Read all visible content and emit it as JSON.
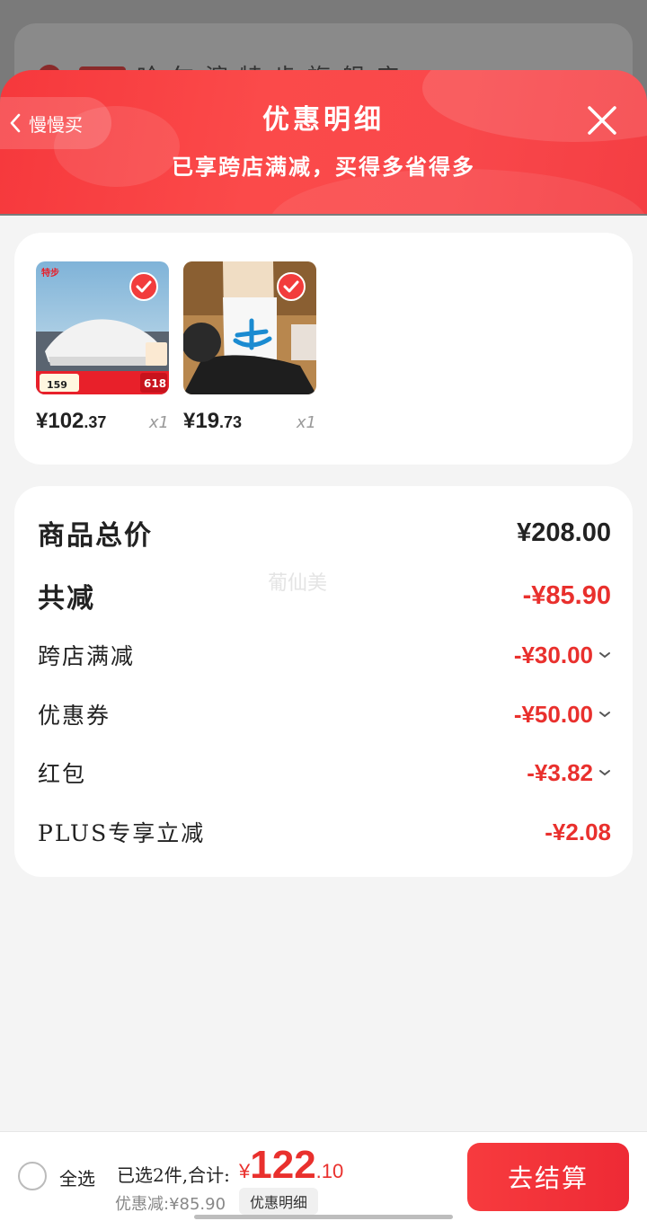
{
  "backdrop": {
    "store_text": "哈尔滨特步旗舰店"
  },
  "header": {
    "back_label": "慢慢买",
    "title": "优惠明细",
    "subtitle": "已享跨店满减，买得多省得多"
  },
  "products": [
    {
      "price_int": "¥102",
      "price_dec": ".37",
      "qty": "x1",
      "badge_price": "159",
      "badge_618": "618",
      "brand": "特步"
    },
    {
      "price_int": "¥19",
      "price_dec": ".73",
      "qty": "x1"
    }
  ],
  "summary": {
    "total_label": "商品总价",
    "total_value": "¥208.00",
    "discount_label": "共减",
    "discount_value": "-¥85.90",
    "watermark": "葡仙美",
    "items": [
      {
        "label": "跨店满减",
        "value": "-¥30.00",
        "expandable": true
      },
      {
        "label": "优惠券",
        "value": "-¥50.00",
        "expandable": true
      },
      {
        "label": "红包",
        "value": "-¥3.82",
        "expandable": true
      },
      {
        "label": "PLUS专享立减",
        "value": "-¥2.08",
        "expandable": false
      }
    ]
  },
  "bottom": {
    "select_all": "全选",
    "selected_text": "已选2件,合计:",
    "currency": "¥",
    "total_int": "122",
    "total_dec": ".10",
    "discount_text": "优惠减:¥85.90",
    "detail_button": "优惠明细",
    "checkout_button": "去结算"
  },
  "colors": {
    "accent": "#e9302d",
    "header": "#f9484b"
  }
}
